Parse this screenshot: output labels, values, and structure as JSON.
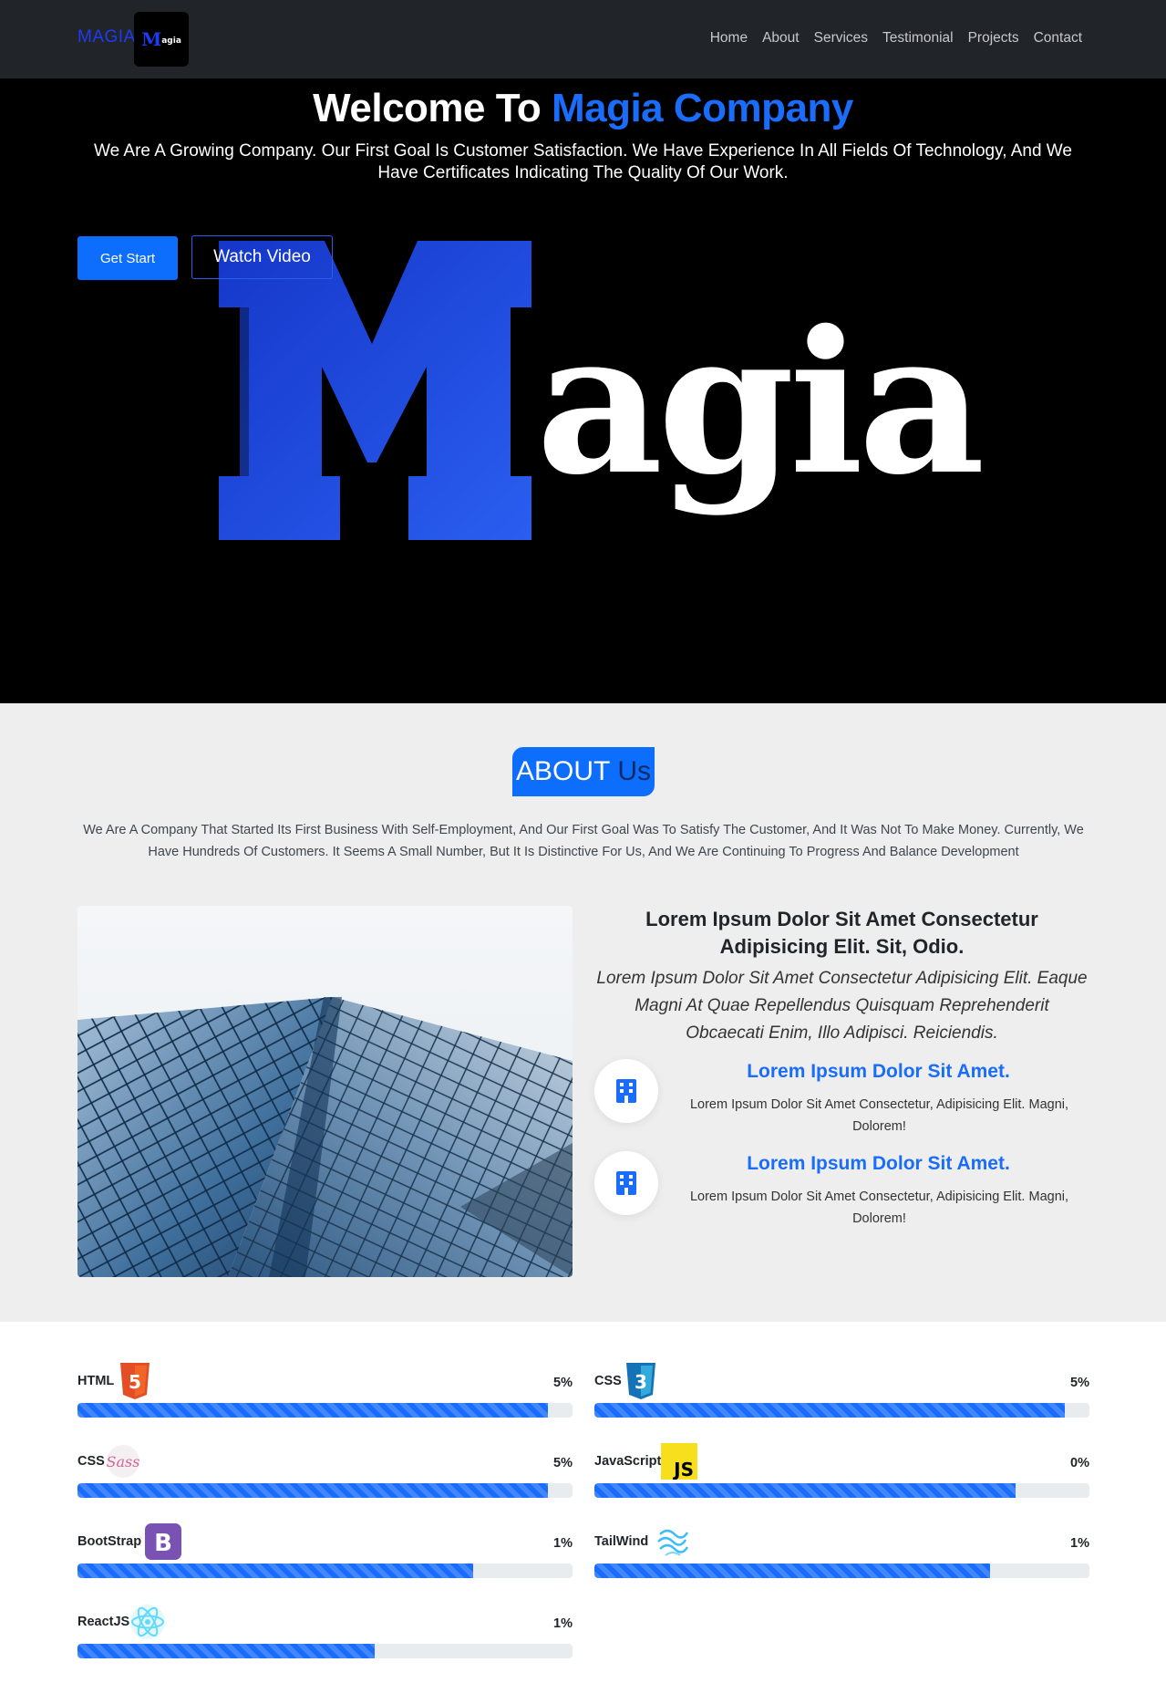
{
  "nav": {
    "brand": "MAGIA",
    "logo_text": "Magia",
    "links": [
      "Home",
      "About",
      "Services",
      "Testimonial",
      "Projects",
      "Contact"
    ]
  },
  "hero": {
    "title_prefix": "Welcome To ",
    "title_accent": "Magia Company",
    "subtitle": "We Are A Growing Company. Our First Goal Is Customer Satisfaction. We Have Experience In All Fields Of Technology, And We Have Certificates Indicating The Quality Of Our Work.",
    "start_button": "Get Start",
    "video_button": "Watch Video",
    "logo_text": "Magia"
  },
  "about": {
    "badge_word1": "ABOUT",
    "badge_word2": "Us",
    "description": "We Are A Company That Started Its First Business With Self-Employment, And Our First Goal Was To Satisfy The Customer, And It Was Not To Make Money. Currently, We Have Hundreds Of Customers. It Seems A Small Number, But It Is Distinctive For Us, And We Are Continuing To Progress And Balance Development",
    "heading": "Lorem Ipsum Dolor Sit Amet Consectetur Adipisicing Elit. Sit, Odio.",
    "lead": "Lorem Ipsum Dolor Sit Amet Consectetur Adipisicing Elit. Eaque Magni At Quae Repellendus Quisquam Reprehenderit Obcaecati Enim, Illo Adipisci. Reiciendis.",
    "features": [
      {
        "title": "Lorem Ipsum Dolor Sit Amet.",
        "text": "Lorem Ipsum Dolor Sit Amet Consectetur, Adipisicing Elit. Magni, Dolorem!",
        "icon": "building-icon"
      },
      {
        "title": "Lorem Ipsum Dolor Sit Amet.",
        "text": "Lorem Ipsum Dolor Sit Amet Consectetur, Adipisicing Elit. Magni, Dolorem!",
        "icon": "building-icon"
      }
    ]
  },
  "skills": [
    {
      "label": "HTML",
      "percent_text": "5%",
      "progress": 0.95,
      "icon": "html5-icon"
    },
    {
      "label": "CSS",
      "percent_text": "5%",
      "progress": 0.95,
      "icon": "css3-icon"
    },
    {
      "label": "CSS",
      "percent_text": "5%",
      "progress": 0.95,
      "icon": "sass-icon"
    },
    {
      "label": "JavaScript",
      "percent_text": "0%",
      "progress": 0.85,
      "icon": "javascript-icon"
    },
    {
      "label": "BootStrap",
      "percent_text": "1%",
      "progress": 0.8,
      "icon": "bootstrap-icon"
    },
    {
      "label": "TailWind",
      "percent_text": "1%",
      "progress": 0.8,
      "icon": "tailwind-icon"
    },
    {
      "label": "ReactJS",
      "percent_text": "1%",
      "progress": 0.6,
      "icon": "react-icon"
    }
  ],
  "colors": {
    "accent": "#1a6dfa",
    "brand": "#1d3cf0",
    "navbar": "#212529",
    "about_bg": "#eeeeee"
  }
}
